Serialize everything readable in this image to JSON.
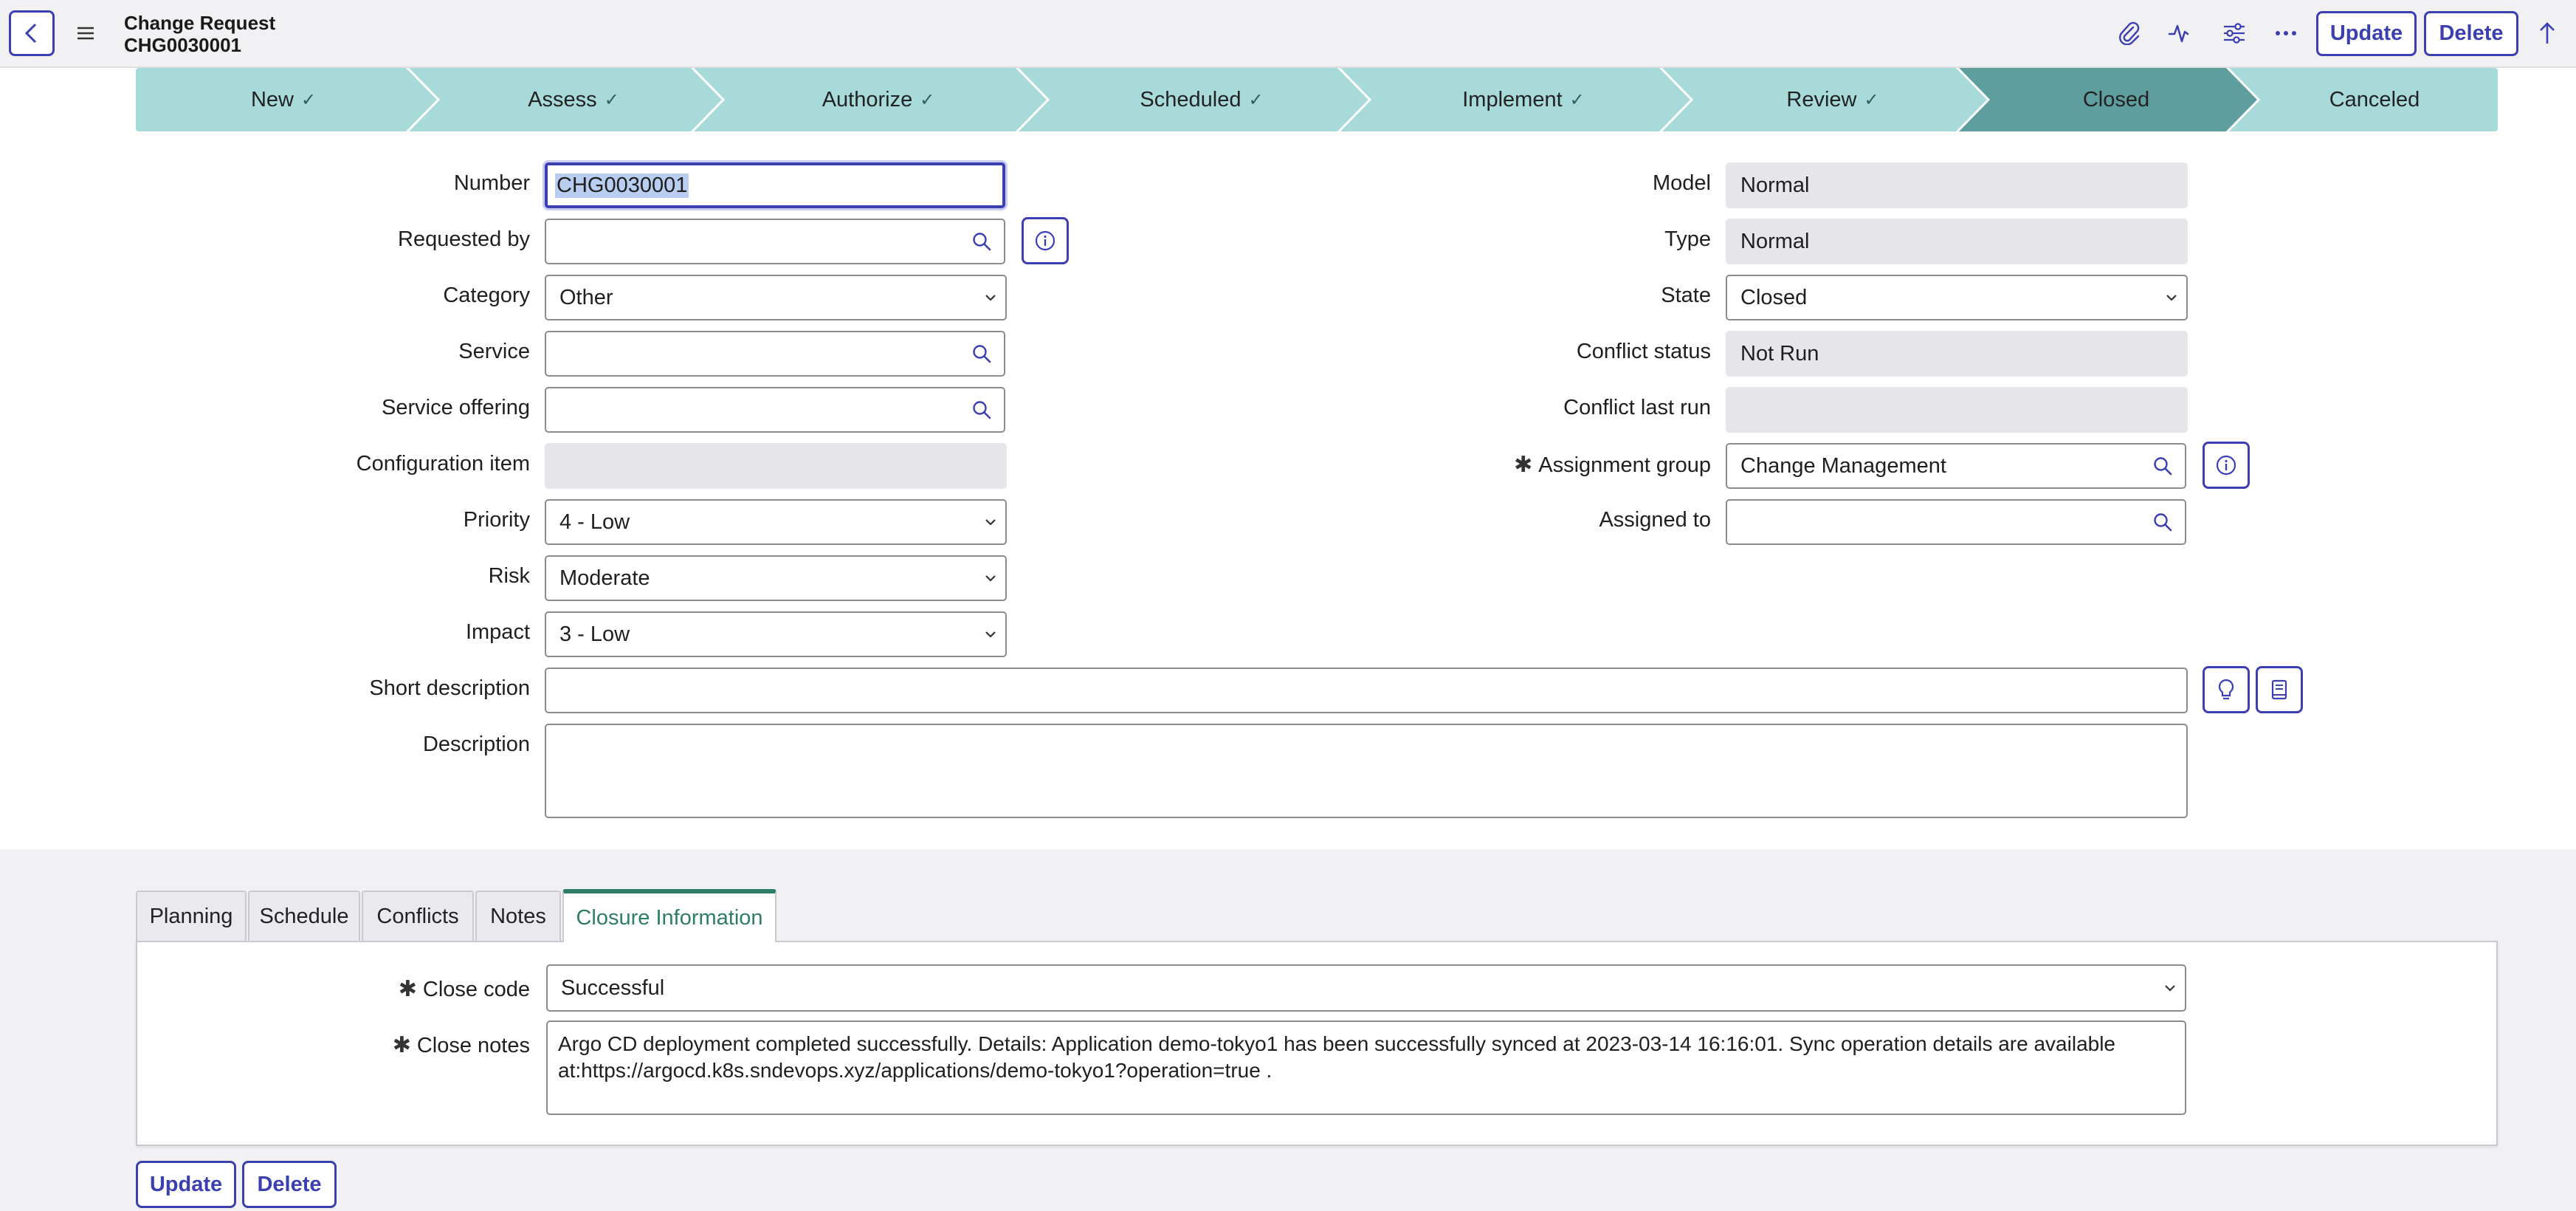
{
  "header": {
    "record_type": "Change Request",
    "record_number": "CHG0030001",
    "update_label": "Update",
    "delete_label": "Delete"
  },
  "process_flow": [
    {
      "label": "New",
      "done": true
    },
    {
      "label": "Assess",
      "done": true
    },
    {
      "label": "Authorize",
      "done": true
    },
    {
      "label": "Scheduled",
      "done": true
    },
    {
      "label": "Implement",
      "done": true
    },
    {
      "label": "Review",
      "done": true
    },
    {
      "label": "Closed",
      "done": false,
      "current": true
    },
    {
      "label": "Canceled",
      "done": false
    }
  ],
  "form": {
    "number": {
      "label": "Number",
      "value": "CHG0030001"
    },
    "requested_by": {
      "label": "Requested by",
      "value": ""
    },
    "category": {
      "label": "Category",
      "value": "Other"
    },
    "service": {
      "label": "Service",
      "value": ""
    },
    "service_offering": {
      "label": "Service offering",
      "value": ""
    },
    "configuration_item": {
      "label": "Configuration item",
      "value": ""
    },
    "priority": {
      "label": "Priority",
      "value": "4 - Low"
    },
    "risk": {
      "label": "Risk",
      "value": "Moderate"
    },
    "impact": {
      "label": "Impact",
      "value": "3 - Low"
    },
    "model": {
      "label": "Model",
      "value": "Normal"
    },
    "type": {
      "label": "Type",
      "value": "Normal"
    },
    "state": {
      "label": "State",
      "value": "Closed"
    },
    "conflict_status": {
      "label": "Conflict status",
      "value": "Not Run"
    },
    "conflict_last_run": {
      "label": "Conflict last run",
      "value": ""
    },
    "assignment_group": {
      "label": "Assignment group",
      "value": "Change Management",
      "required_marker": "✱"
    },
    "assigned_to": {
      "label": "Assigned to",
      "value": ""
    },
    "short_description": {
      "label": "Short description",
      "value": ""
    },
    "description": {
      "label": "Description",
      "value": ""
    }
  },
  "tabs": [
    {
      "label": "Planning"
    },
    {
      "label": "Schedule"
    },
    {
      "label": "Conflicts"
    },
    {
      "label": "Notes"
    },
    {
      "label": "Closure Information",
      "active": true
    }
  ],
  "closure": {
    "close_code": {
      "label": "Close code",
      "value": "Successful",
      "required_marker": "✱"
    },
    "close_notes": {
      "label": "Close notes",
      "required_marker": "✱",
      "line1": "Argo CD deployment completed successfully. Details: Application demo-tokyo1 has been successfully synced at 2023-03-14 16:16:01. Sync operation details are available",
      "line2": "at:https://argocd.k8s.sndevops.xyz/applications/demo-tokyo1?operation=true ."
    }
  },
  "footer": {
    "update_label": "Update",
    "delete_label": "Delete"
  },
  "colors": {
    "accent": "#3b3fb0",
    "flow_stage": "#a8dada",
    "flow_current": "#5f9e9e",
    "active_tab": "#2e7d64"
  }
}
